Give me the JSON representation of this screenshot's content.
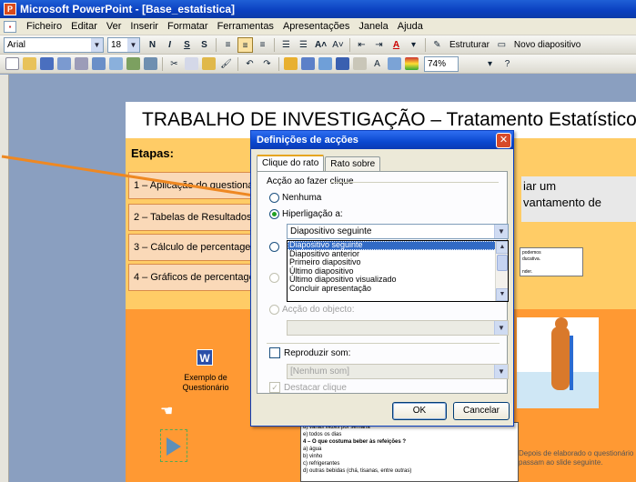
{
  "window": {
    "title": "Microsoft PowerPoint - [Base_estatistica]"
  },
  "menu": [
    "Ficheiro",
    "Editar",
    "Ver",
    "Inserir",
    "Formatar",
    "Ferramentas",
    "Apresentações",
    "Janela",
    "Ajuda"
  ],
  "format_toolbar": {
    "font": "Arial",
    "size": "18",
    "bold": "N",
    "italic": "I",
    "underline": "S",
    "shadow": "S",
    "structure": "Estruturar",
    "new_slide": "Novo diapositivo"
  },
  "standard_toolbar": {
    "zoom": "74%"
  },
  "slide": {
    "title": "TRABALHO DE INVESTIGAÇÃO – Tratamento Estatístico",
    "etapas": "Etapas:",
    "steps": [
      "1 – Aplicação do questionário",
      "2 – Tabelas de Resultados",
      "3 – Cálculo de percentagens",
      "4 – Gráficos de percentagens"
    ],
    "right_text": "iar um\nvantamento de",
    "small_box_text": "podemos\nducativa.\n\nnder.",
    "word_label": "Exemplo de\nQuestionário",
    "word_letter": "W",
    "after_text": "Depois de elaborado o questionário\npassam ao slide seguinte.",
    "questions": [
      "d)  várias vezes por semana",
      "e)  todos os dias",
      "4 – O que costuma beber às refeições ?",
      "a)  água",
      "b)  vinho",
      "c)  refrigerantes",
      "d)  outras bebidas (chá, tisanas, entre outras)"
    ]
  },
  "dialog": {
    "title": "Definições de acções",
    "tabs": [
      "Clique do rato",
      "Rato sobre"
    ],
    "group_label": "Acção ao fazer clique",
    "option_none": "Nenhuma",
    "option_hyperlink": "Hiperligação a:",
    "hyperlink_value": "Diapositivo seguinte",
    "list_options": [
      "Diapositivo seguinte",
      "Diapositivo anterior",
      "Primeiro diapositivo",
      "Último diapositivo",
      "Último diapositivo visualizado",
      "Concluir apresentação"
    ],
    "option_object_action": "Acção do objecto:",
    "play_sound": "Reproduzir som:",
    "sound_value": "[Nenhum som]",
    "highlight_click": "Destacar clique",
    "ok": "OK",
    "cancel": "Cancelar"
  },
  "colors": {
    "slide_bg": "#ffcc66",
    "slide_band": "#ff9933",
    "titlebar": "#0a3fbf",
    "selection": "#316ac5",
    "arrow": "#ee8822"
  }
}
